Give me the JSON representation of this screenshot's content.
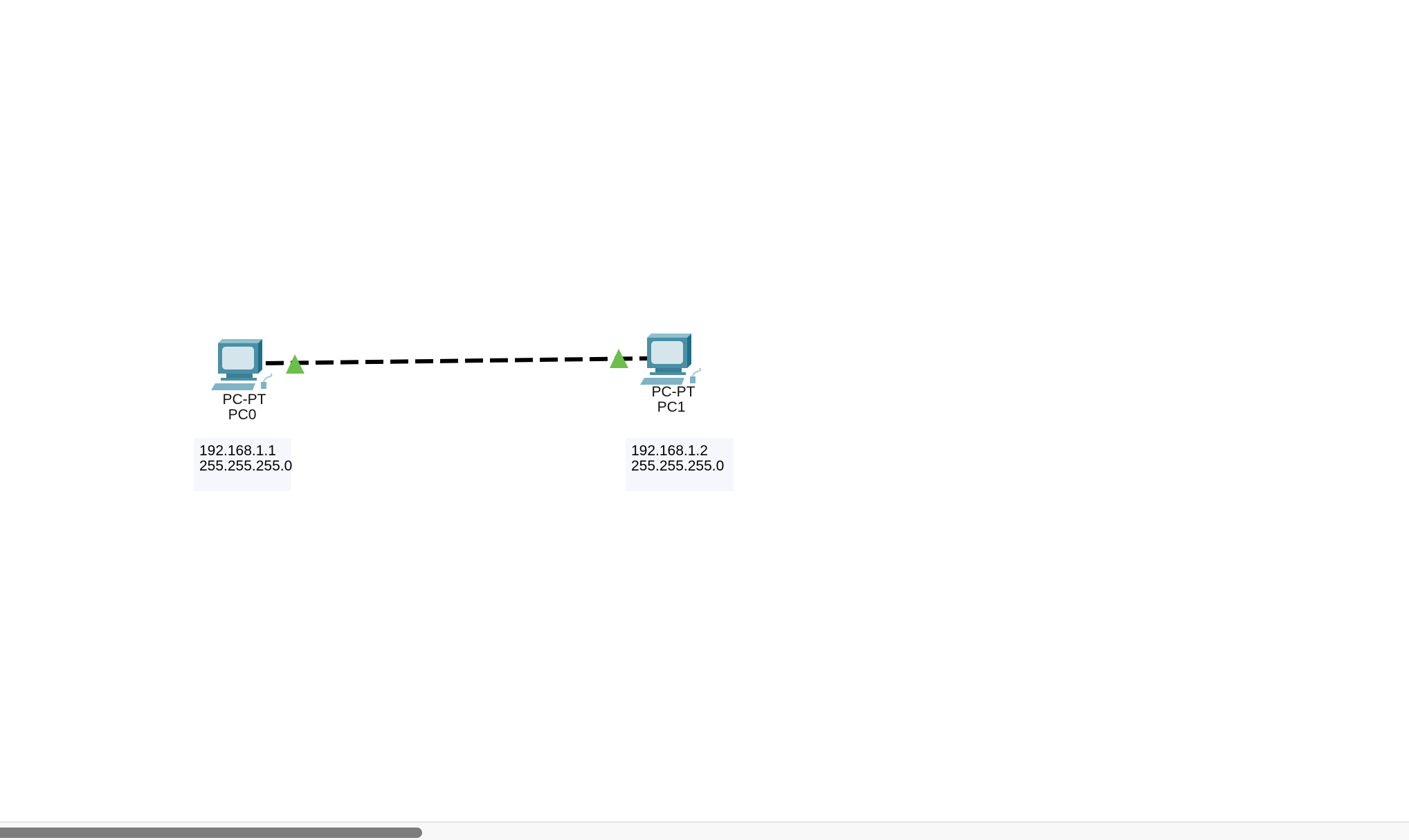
{
  "devices": [
    {
      "model": "PC-PT",
      "name": "PC0",
      "ip": "192.168.1.1",
      "mask": "255.255.255.0"
    },
    {
      "model": "PC-PT",
      "name": "PC1",
      "ip": "192.168.1.2",
      "mask": "255.255.255.0"
    }
  ],
  "link": {
    "type": "crossover-cable",
    "status_color": "#6cc04a"
  },
  "colors": {
    "pc_body": "#4b8fa6",
    "pc_screen": "#d5e5ec"
  }
}
